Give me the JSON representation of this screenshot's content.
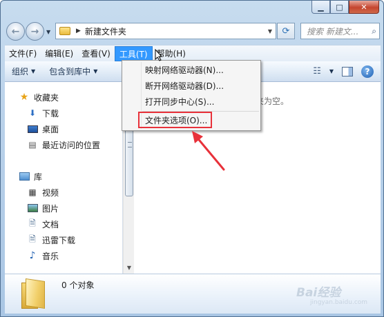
{
  "window": {
    "title_address": "新建文件夹",
    "search_placeholder": "搜索 新建文...",
    "caption_buttons": [
      "minimize",
      "maximize",
      "close"
    ]
  },
  "menubar": [
    {
      "label": "文件(F)"
    },
    {
      "label": "编辑(E)"
    },
    {
      "label": "查看(V)"
    },
    {
      "label": "工具(T)",
      "active": true
    },
    {
      "label": "帮助(H)"
    }
  ],
  "commandbar": {
    "organize": "组织",
    "include_in_library": "包含到库中"
  },
  "sidebar": {
    "favorites": {
      "label": "收藏夹",
      "icon": "star-icon"
    },
    "fav_items": [
      {
        "label": "下载",
        "icon": "downloads-folder-icon"
      },
      {
        "label": "桌面",
        "icon": "desktop-icon"
      },
      {
        "label": "最近访问的位置",
        "icon": "recent-places-icon"
      }
    ],
    "libraries": {
      "label": "库",
      "icon": "library-icon"
    },
    "lib_items": [
      {
        "label": "视频",
        "icon": "video-icon"
      },
      {
        "label": "图片",
        "icon": "pictures-icon"
      },
      {
        "label": "文档",
        "icon": "documents-icon"
      },
      {
        "label": "迅雷下载",
        "icon": "thunder-download-icon"
      },
      {
        "label": "音乐",
        "icon": "music-icon"
      }
    ]
  },
  "main": {
    "empty_text": "夹为空。"
  },
  "tools_menu": {
    "items": [
      {
        "label": "映射网络驱动器(N)..."
      },
      {
        "label": "断开网络驱动器(D)..."
      },
      {
        "label": "打开同步中心(S)..."
      },
      {
        "label": "文件夹选项(O)...",
        "highlighted": true
      }
    ]
  },
  "details": {
    "status": "0 个对象",
    "watermark": "Bai经验",
    "watermark_sub": "jingyan.baidu.com"
  },
  "colors": {
    "annotation": "#e8313a",
    "menu_active": "#3399ff"
  }
}
